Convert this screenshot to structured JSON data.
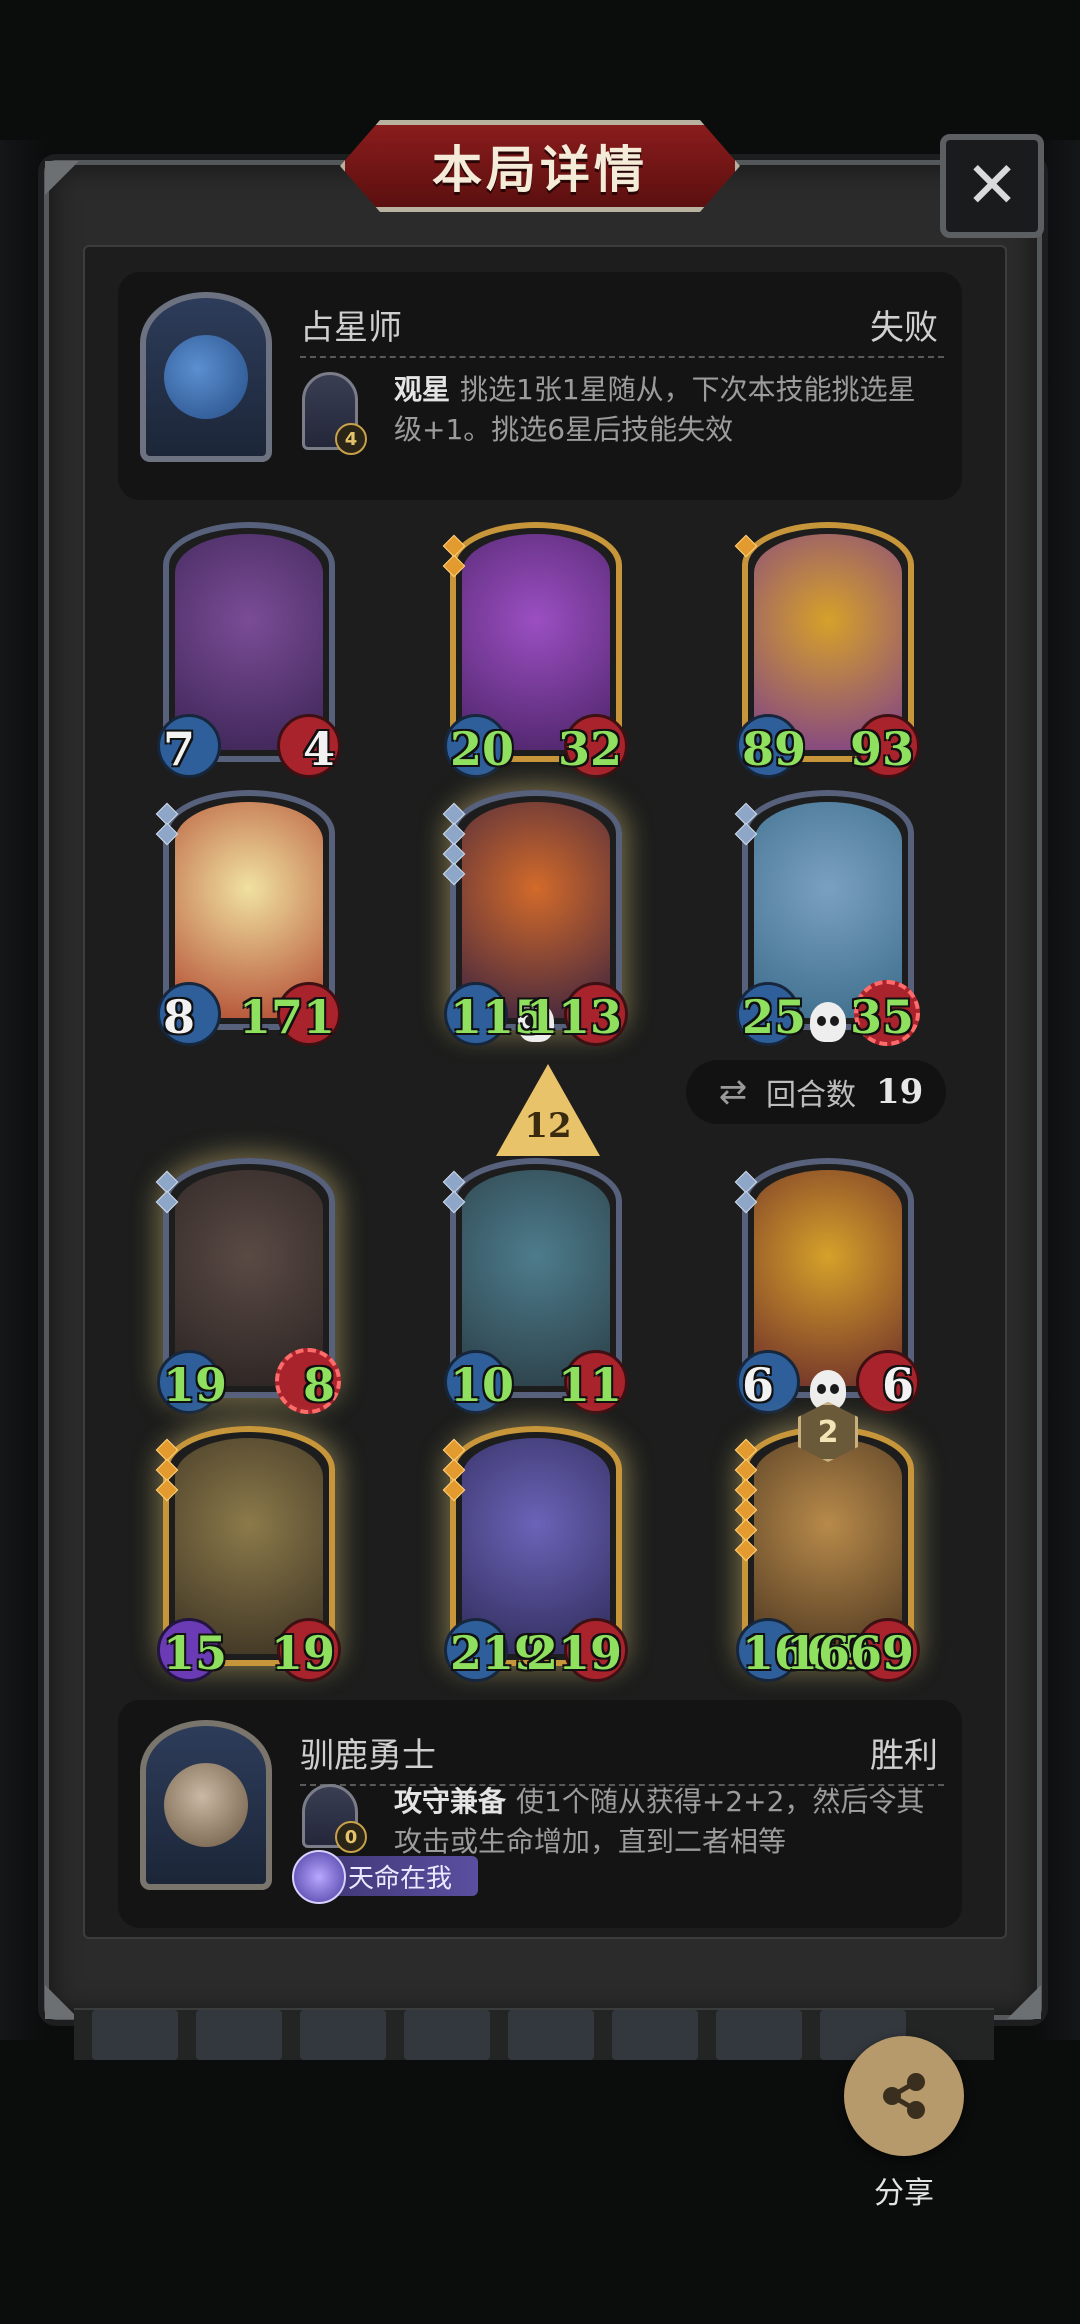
{
  "header": {
    "title": "本局详情",
    "close_glyph": "✕"
  },
  "opponent": {
    "name": "占星师",
    "result": "失败",
    "skill": {
      "cost": "4",
      "name": "观星",
      "description": "挑选1张1星随从，下次本技能挑选星级+1。挑选6星后技能失效"
    }
  },
  "opponent_board": [
    {
      "attack": "7",
      "health": "4",
      "atk_color": "white",
      "hp_color": "white",
      "frame": "silver",
      "stars": 0,
      "art": [
        "#7a4c96",
        "#3b2454"
      ]
    },
    {
      "attack": "20",
      "health": "32",
      "atk_color": "green",
      "hp_color": "green",
      "frame": "gold",
      "stars": 2,
      "art": [
        "#9b4fc2",
        "#4b2366"
      ]
    },
    {
      "attack": "89",
      "health": "93",
      "atk_color": "green",
      "hp_color": "green",
      "frame": "gold",
      "stars": 1,
      "art": [
        "#d6a12a",
        "#7c3e8c"
      ]
    },
    {
      "attack": "8",
      "health": "171",
      "atk_color": "white",
      "hp_color": "green",
      "frame": "silver",
      "stars": 2,
      "art": [
        "#f0e1a0",
        "#b0462e"
      ]
    },
    {
      "attack": "115",
      "health": "113",
      "atk_color": "green",
      "hp_color": "green",
      "frame": "silver",
      "stars": 4,
      "art": [
        "#d26a2a",
        "#3a2240"
      ],
      "skull": true,
      "glow": true
    },
    {
      "attack": "25",
      "health": "35",
      "atk_color": "green",
      "hp_color": "green",
      "frame": "silver",
      "stars": 2,
      "art": [
        "#7aa0c0",
        "#3b6b8a"
      ],
      "skull": true,
      "burst": true
    }
  ],
  "round_marker": "12",
  "turn_count": {
    "label": "回合数",
    "value": "19",
    "icon": "swap-cycle-icon"
  },
  "player_board": [
    {
      "attack": "19",
      "health": "8",
      "atk_color": "green",
      "hp_color": "green",
      "frame": "silver",
      "stars": 2,
      "art": [
        "#5a4a44",
        "#2a2322"
      ],
      "glow": true,
      "burst": true
    },
    {
      "attack": "10",
      "health": "11",
      "atk_color": "green",
      "hp_color": "green",
      "frame": "silver",
      "stars": 2,
      "art": [
        "#4d7c8c",
        "#2a3d45"
      ]
    },
    {
      "attack": "6",
      "health": "6",
      "atk_color": "white",
      "hp_color": "white",
      "frame": "silver",
      "stars": 2,
      "art": [
        "#d6a12a",
        "#6a2b2a"
      ],
      "skull": true
    },
    {
      "attack": "15",
      "health": "19",
      "atk_color": "green",
      "hp_color": "green",
      "frame": "gold",
      "stars": 3,
      "art": [
        "#8c7a4a",
        "#3a3122"
      ],
      "purple_atk": true,
      "glow": true
    },
    {
      "attack": "219",
      "health": "219",
      "atk_color": "green",
      "hp_color": "green",
      "frame": "gold",
      "stars": 3,
      "art": [
        "#6b63b8",
        "#2d2a56"
      ],
      "glow": true
    },
    {
      "attack": "1669",
      "health": "1669",
      "atk_color": "green",
      "hp_color": "green",
      "frame": "gold",
      "stars": 6,
      "art": [
        "#b88a4a",
        "#4a3520"
      ],
      "glow": true,
      "badge": "2"
    }
  ],
  "player": {
    "name": "驯鹿勇士",
    "result": "胜利",
    "skill": {
      "cost": "0",
      "name": "攻守兼备",
      "description": "使1个随从获得+2+2，然后令其攻击或生命增加，直到二者相等"
    },
    "destiny": "天命在我"
  },
  "share": {
    "label": "分享",
    "icon": "share-icon"
  },
  "colors": {
    "panel": "#2a2b2a",
    "title_red": "#8a1c1c",
    "green_stat": "#8fe05f",
    "gold_frame": "#c8963a",
    "share_btn": "#b79a6b"
  }
}
